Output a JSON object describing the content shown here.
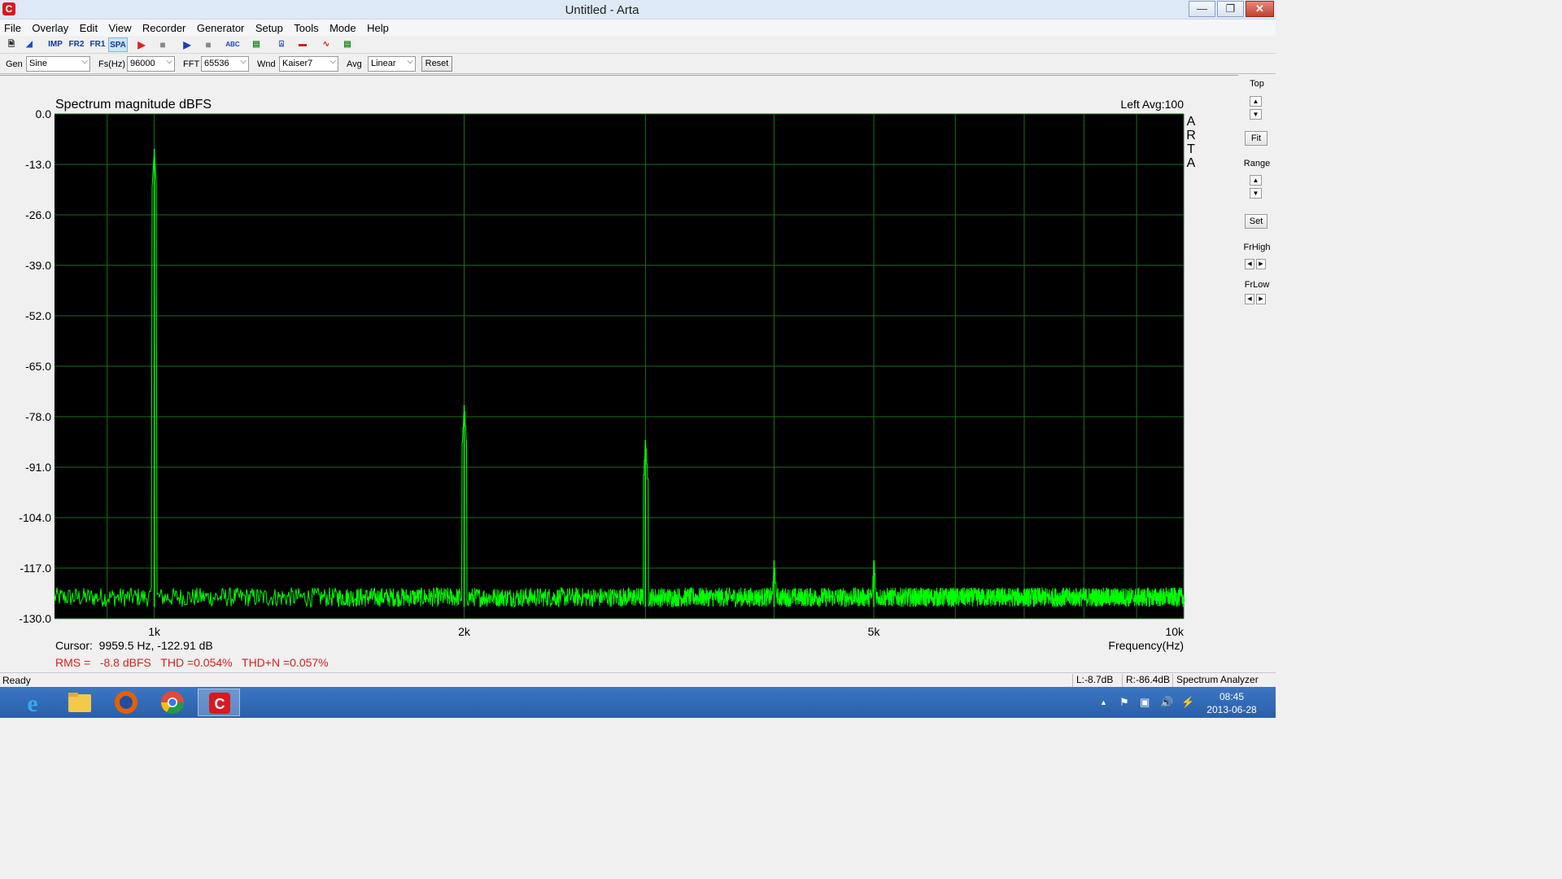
{
  "window": {
    "title": "Untitled - Arta"
  },
  "menu": [
    "File",
    "Overlay",
    "Edit",
    "View",
    "Recorder",
    "Generator",
    "Setup",
    "Tools",
    "Mode",
    "Help"
  ],
  "toolbar": {
    "imp": "IMP",
    "fr2": "FR2",
    "fr1": "FR1",
    "spa": "SPA"
  },
  "controls": {
    "gen_label": "Gen",
    "gen_value": "Sine",
    "fs_label": "Fs(Hz)",
    "fs_value": "96000",
    "fft_label": "FFT",
    "fft_value": "65536",
    "wnd_label": "Wnd",
    "wnd_value": "Kaiser7",
    "avg_label": "Avg",
    "avg_value": "Linear",
    "reset_label": "Reset"
  },
  "right_panel": {
    "top_label": "Top",
    "fit_label": "Fit",
    "range_label": "Range",
    "set_label": "Set",
    "frhigh_label": "FrHigh",
    "frlow_label": "FrLow"
  },
  "chart_data": {
    "type": "line",
    "title": "Spectrum magnitude dBFS",
    "channel_info": "Left  Avg:100",
    "watermark": [
      "A",
      "R",
      "T",
      "A"
    ],
    "xlabel": "Frequency(Hz)",
    "xscale": "log",
    "xlim": [
      800,
      10000
    ],
    "ylim": [
      -130,
      0
    ],
    "y_ticks": [
      "0.0",
      "-13.0",
      "-26.0",
      "-39.0",
      "-52.0",
      "-65.0",
      "-78.0",
      "-91.0",
      "-104.0",
      "-117.0",
      "-130.0"
    ],
    "x_tick_labels": [
      {
        "f": 1000,
        "label": "1k"
      },
      {
        "f": 2000,
        "label": "2k"
      },
      {
        "f": 5000,
        "label": "5k"
      },
      {
        "f": 10000,
        "label": "10k"
      }
    ],
    "grid": true,
    "background": "#000000",
    "grid_color": "#1f6b1f",
    "trace_color": "#00ff00",
    "noise_floor_db": [
      -127,
      -122
    ],
    "peaks": [
      {
        "freq": 1000,
        "db": -9
      },
      {
        "freq": 2000,
        "db": -75
      },
      {
        "freq": 3000,
        "db": -84
      },
      {
        "freq": 4000,
        "db": -115
      },
      {
        "freq": 5000,
        "db": -115
      }
    ],
    "cursor_text": "Cursor:  9959.5 Hz, -122.91 dB",
    "summary_text": "RMS =   -8.8 dBFS   THD =0.054%   THD+N =0.057%"
  },
  "status": {
    "ready": "Ready",
    "left_level": "L:-8.7dB",
    "right_level": "R:-86.4dB",
    "mode": "Spectrum Analyzer"
  },
  "taskbar": {
    "apps": [
      "ie-icon",
      "explorer-icon",
      "firefox-icon",
      "chrome-icon",
      "arta-icon"
    ],
    "time": "08:45",
    "date": "2013-06-28"
  }
}
